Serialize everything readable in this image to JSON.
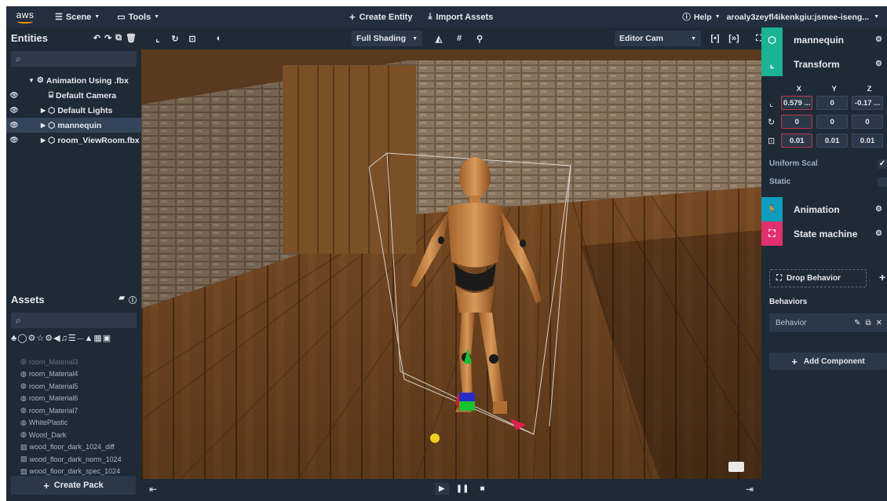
{
  "topbar": {
    "logo": "aws",
    "scene_menu": "Scene",
    "tools_menu": "Tools",
    "create_entity": "Create Entity",
    "import_assets": "Import Assets",
    "help": "Help",
    "user": "aroaly3zeyfl4ikenkgiu:jsmee-iseng..."
  },
  "entities": {
    "title": "Entities",
    "tree": [
      {
        "label": "Animation Using .fbx",
        "level": 0,
        "selected": false,
        "eye": false
      },
      {
        "label": "Default Camera",
        "level": 1,
        "selected": false,
        "eye": true
      },
      {
        "label": "Default Lights",
        "level": 1,
        "selected": false,
        "eye": true
      },
      {
        "label": "mannequin",
        "level": 1,
        "selected": true,
        "eye": true
      },
      {
        "label": "room_ViewRoom.fbx",
        "level": 1,
        "selected": false,
        "eye": true
      }
    ]
  },
  "assets": {
    "title": "Assets",
    "items": [
      "room_Material4",
      "room_Material5",
      "room_Material6",
      "room_Material7",
      "WhitePlastic",
      "Wood_Dark",
      "wood_floor_dark_1024_diff",
      "wood_floor_dark_norm_1024",
      "wood_floor_dark_spec_1024"
    ],
    "create_pack": "Create Pack"
  },
  "viewport": {
    "shading": "Full Shading",
    "camera": "Editor Cam"
  },
  "inspector": {
    "entity_name": "mannequin",
    "transform": "Transform",
    "axes": [
      "X",
      "Y",
      "Z"
    ],
    "position": [
      "0.579 ...",
      "0",
      "-0.17 ..."
    ],
    "rotation": [
      "0",
      "0",
      "0"
    ],
    "scale": [
      "0.01",
      "0.01",
      "0.01"
    ],
    "uniform_scale": "Uniform Scal",
    "static": "Static",
    "animation": "Animation",
    "state_machine": "State machine",
    "drop_behavior": "Drop Behavior",
    "behaviors_heading": "Behaviors",
    "behavior_item": "Behavior",
    "add_component": "Add Component"
  },
  "colors": {
    "teal": "#1ab394",
    "cyan": "#0d9dbd",
    "pink": "#e0306e",
    "panel": "#1f2a37",
    "topbar": "#232f3e"
  }
}
